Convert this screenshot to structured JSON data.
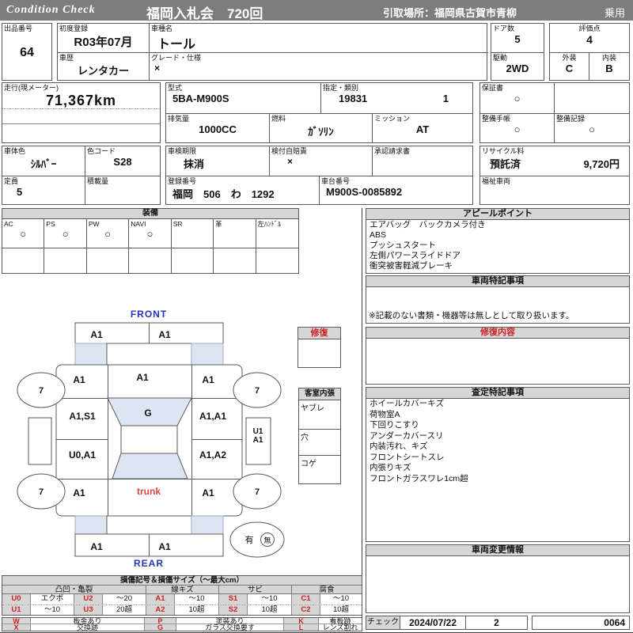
{
  "header": {
    "brand": "Condition  Check",
    "auction": "福岡入札会　720回",
    "pickup": "引取場所：福岡県古賀市青柳",
    "category": "乗用"
  },
  "vehicle": {
    "lot_label": "出品番号",
    "lot": "64",
    "first_reg_label": "初度登録",
    "first_reg": "R03年07月",
    "model_name_label": "車種名",
    "model_name": "トール",
    "history_label": "車歴",
    "history": "レンタカー",
    "grade_label": "グレード・仕様",
    "grade": "×",
    "doors_label": "ドア数",
    "doors": "5",
    "drive_label": "駆動",
    "drive": "2WD",
    "score_label": "評価点",
    "score": "4",
    "exterior_label": "外装",
    "exterior_grade": "C",
    "interior_label": "内装",
    "interior_grade": "B",
    "mileage_label": "走行(現メーター)",
    "mileage": "71,367km",
    "model_code_label": "型式",
    "model_code": "5BA-M900S",
    "class_label": "指定・類別",
    "class_no": "19831",
    "class_sub": "1",
    "displacement_label": "排気量",
    "displacement": "1000CC",
    "fuel_label": "燃料",
    "fuel": "ｶﾞｿﾘﾝ",
    "mission_label": "ミッション",
    "mission": "AT",
    "warranty_label": "保証書",
    "warranty_mark": "○",
    "book_label": "整備手帳",
    "book_mark": "○",
    "record_label": "整備記録",
    "record_mark": "○",
    "body_color_label": "車体色",
    "body_color": "ｼﾙﾊﾞｰ",
    "color_code_label": "色コード",
    "color_code": "S28",
    "shaken_label": "車検期限",
    "shaken": "抹消",
    "jibaiseki_label": "検付自賠責",
    "jibaiseki": "×",
    "approval_label": "承認請求書",
    "approval": "",
    "capacity_label": "定員",
    "capacity": "5",
    "load_label": "積載量",
    "load": "",
    "reg_label": "登録番号",
    "reg_no": "福岡　506　わ　1292",
    "chassis_label": "車台番号",
    "chassis": "M900S-0085892",
    "recycle_label": "リサイクル料",
    "recycle_status": "預託済",
    "recycle_fee": "9,720円",
    "welfare_label": "福祉車両",
    "welfare": ""
  },
  "equipment": {
    "title": "装備",
    "items": [
      {
        "label": "AC",
        "mark": "○"
      },
      {
        "label": "PS",
        "mark": "○"
      },
      {
        "label": "PW",
        "mark": "○"
      },
      {
        "label": "NAVI",
        "mark": "○"
      },
      {
        "label": "SR",
        "mark": ""
      },
      {
        "label": "革",
        "mark": ""
      },
      {
        "label": "左ﾊﾝﾄﾞﾙ",
        "mark": ""
      }
    ]
  },
  "appeal": {
    "title": "アピールポイント",
    "lines": [
      "エアバッグ　バックカメラ付き",
      "ABS",
      "プッシュスタート",
      "左側パワースライドドア",
      "衝突被害軽減ブレーキ"
    ]
  },
  "vehicle_notes": {
    "title": "車両特記事項",
    "note": "※記載のない書類・機器等は無しとして取り扱います。"
  },
  "repair_content": {
    "title": "修復内容"
  },
  "assessment": {
    "title": "査定特記事項",
    "lines": [
      "ホイールカバーキズ",
      "荷物室A",
      "下回りこすり",
      "アンダーカバースリ",
      "内装汚れ、キズ",
      "フロントシートスレ",
      "内張りキズ",
      "フロントガラスワレ1cm超"
    ]
  },
  "change_info": {
    "title": "車両変更情報"
  },
  "check": {
    "label": "チェック",
    "date": "2024/07/22",
    "count": "2",
    "code": "0064"
  },
  "diagram": {
    "front": "FRONT",
    "rear": "REAR",
    "front_bumper_l": "A1",
    "front_bumper_r": "A1",
    "fender_fl": "A1",
    "hood": "A1",
    "fender_fr": "A1",
    "door_fl": "A1,S1",
    "windshield": "G",
    "door_fr": "A1,A1",
    "door_rl": "U0,A1",
    "door_rr": "A1,A2",
    "sill_r1": "U1",
    "sill_r2": "A1",
    "quarter_l": "A1",
    "trunk": "trunk",
    "quarter_r": "A1",
    "rear_bumper_l": "A1",
    "rear_bumper_r": "A1",
    "wheel_fl": "7",
    "wheel_fr": "7",
    "wheel_rl": "7",
    "wheel_rr": "7",
    "spare_present": "有",
    "spare_absent": "無",
    "repair_title": "修復",
    "cabin": {
      "title": "客室内張",
      "rows": [
        "ヤブレ",
        "穴",
        "コゲ"
      ]
    }
  },
  "legend": {
    "title": "損傷記号＆損傷サイズ（～最大cm）",
    "groups": [
      "凸凹・亀裂",
      "線キズ",
      "サビ",
      "腐食"
    ],
    "rows": [
      [
        "U0",
        "エクボ",
        "U2",
        "～20",
        "A1",
        "～10",
        "S1",
        "～10",
        "C1",
        "～10"
      ],
      [
        "U1",
        "～10",
        "U3",
        "20超",
        "A2",
        "10超",
        "S2",
        "10超",
        "C2",
        "10超"
      ]
    ],
    "rows2": [
      [
        "W",
        "板金あり",
        "P",
        "塗装あり",
        "K",
        "看板跡"
      ],
      [
        "X",
        "交換跡",
        "G",
        "ガラス交換要す",
        "L",
        "レンズ割れ"
      ]
    ]
  },
  "colors": {
    "header_bar": "#7d7d7d",
    "section_header_bg": "#d6d6d6",
    "accent_blue": "#2233bb",
    "accent_red": "#cc2222",
    "diagram_fill": "#dce6f2"
  }
}
